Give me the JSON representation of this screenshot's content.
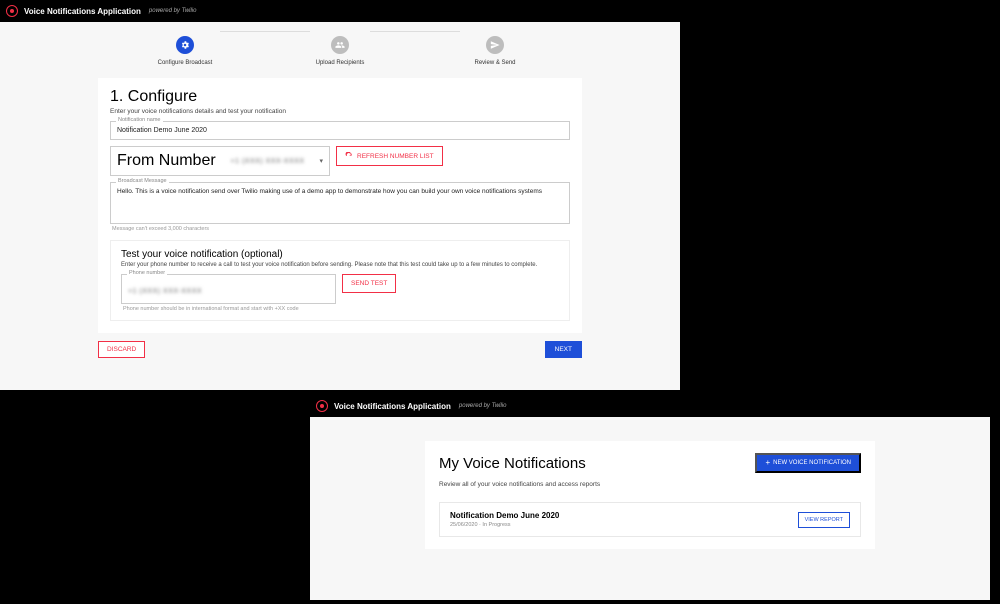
{
  "app": {
    "title": "Voice Notifications Application",
    "subtitle": "powered by Twilio"
  },
  "stepper": {
    "steps": [
      {
        "label": "Configure Broadcast"
      },
      {
        "label": "Upload Recipients"
      },
      {
        "label": "Review & Send"
      }
    ]
  },
  "configure": {
    "heading": "1. Configure",
    "subheading": "Enter your voice notifications details and test your notification",
    "name_label": "Notification name",
    "name_value": "Notification Demo June 2020",
    "from_label": "From Number",
    "from_value_masked": "+1 (XXX) XXX-XXXX",
    "refresh_btn": "REFRESH NUMBER LIST",
    "msg_label": "Broadcast Message",
    "msg_value": "Hello. This is a voice notification send over Twilio making use of a demo app to demonstrate how you can build your own voice notifications systems",
    "msg_helper": "Message can't exceed 3,000 characters",
    "test_heading": "Test your voice notification (optional)",
    "test_sub": "Enter your phone number to receive a call to test your voice notification before sending. Please note that this test could take up to a few minutes to complete.",
    "phone_label": "Phone number",
    "phone_value_masked": "+1 (XXX) XXX-XXXX",
    "phone_helper": "Phone number should be in international format and start with +XX code",
    "send_test_btn": "SEND TEST",
    "discard_btn": "DISCARD",
    "next_btn": "NEXT"
  },
  "list": {
    "heading": "My Voice Notifications",
    "subheading": "Review all of your voice notifications and access reports",
    "new_btn": "NEW VOICE NOTIFICATION",
    "items": [
      {
        "title": "Notification Demo June 2020",
        "date": "25/06/2020",
        "status": "In Progress",
        "view_btn": "VIEW REPORT"
      }
    ]
  }
}
